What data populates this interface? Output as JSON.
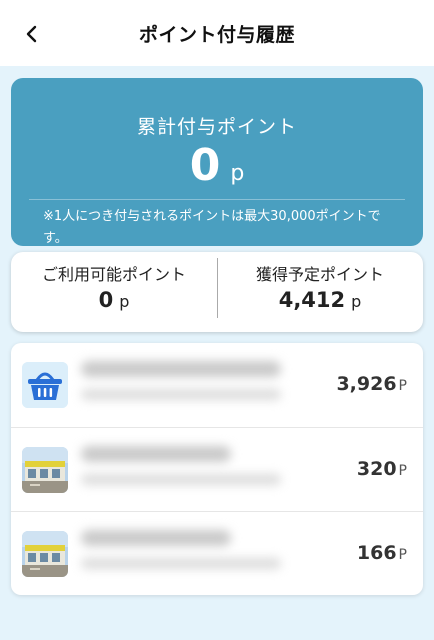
{
  "header": {
    "title": "ポイント付与履歴",
    "back_icon": "chevron-left-icon"
  },
  "total": {
    "label": "累計付与ポイント",
    "value": "0",
    "unit": "p",
    "note": "※1人につき付与されるポイントは最大30,000ポイントです。",
    "bg_color": "#4a9fc0"
  },
  "balance": {
    "available": {
      "label": "ご利用可能ポイント",
      "value": "0",
      "unit": "p"
    },
    "pending": {
      "label": "獲得予定ポイント",
      "value": "4,412",
      "unit": "p"
    }
  },
  "history": {
    "items": [
      {
        "icon": "shopping-basket-icon",
        "amount": "3,926",
        "unit": "P"
      },
      {
        "icon": "store-photo",
        "amount": "320",
        "unit": "P"
      },
      {
        "icon": "store-photo",
        "amount": "166",
        "unit": "P"
      }
    ]
  }
}
